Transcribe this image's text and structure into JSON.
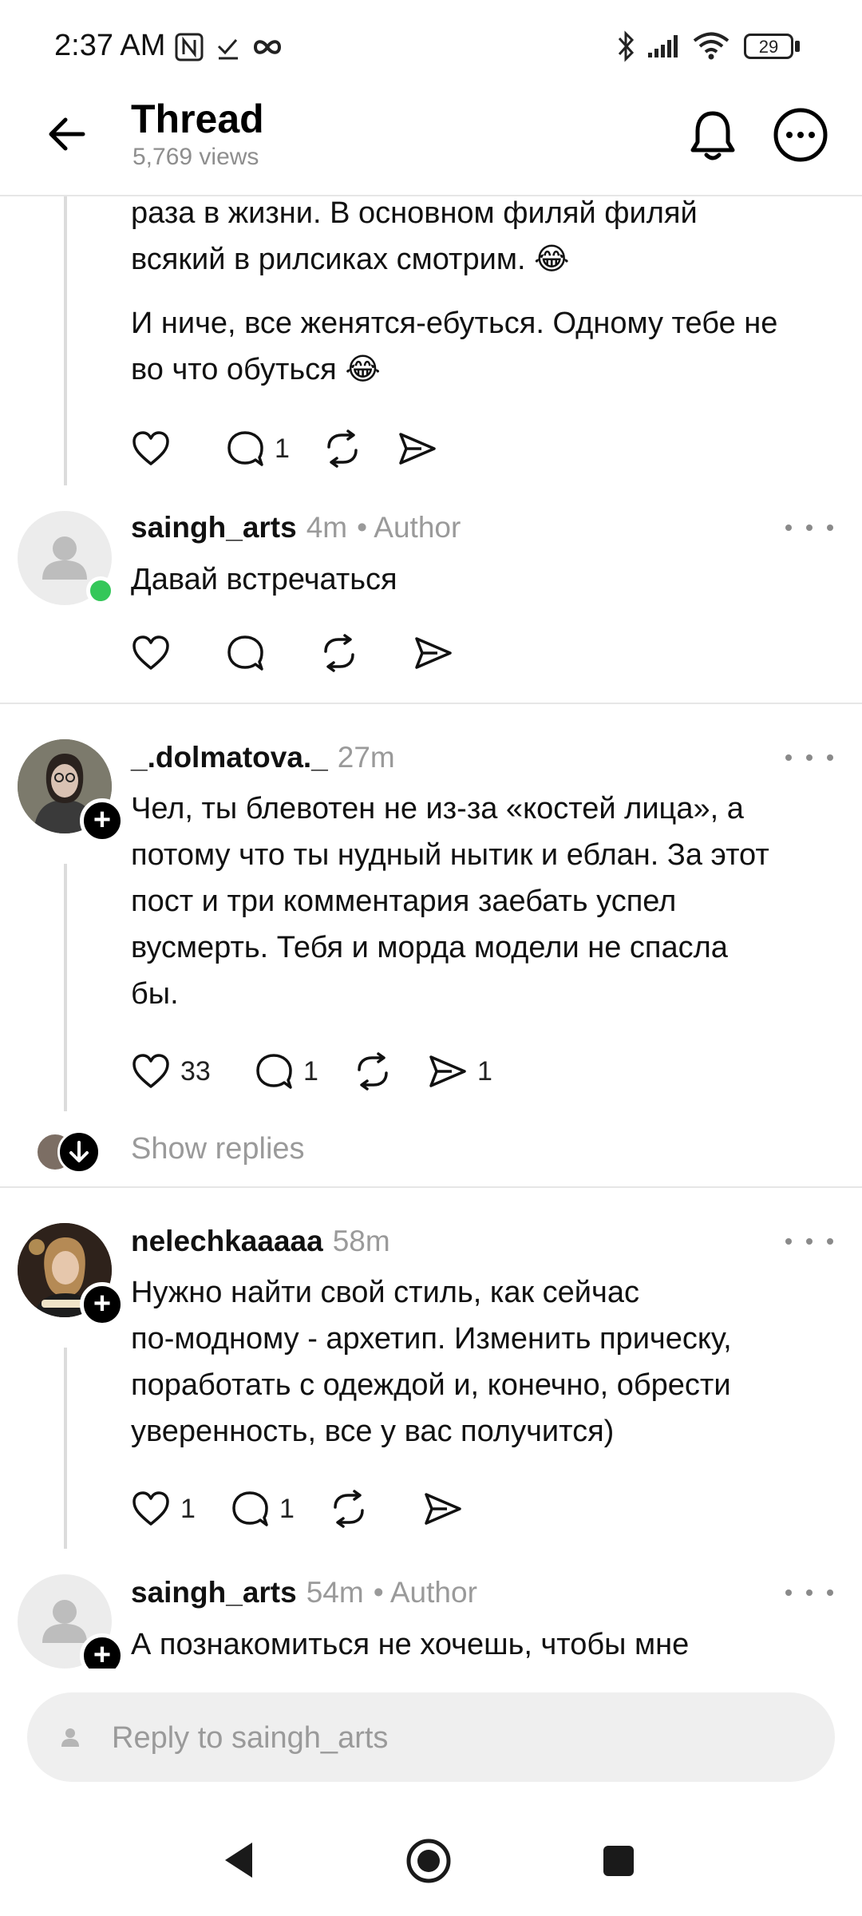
{
  "status_bar": {
    "time": "2:37 AM",
    "battery": "29"
  },
  "header": {
    "title": "Thread",
    "views": "5,769 views"
  },
  "posts": [
    {
      "text_lines": [
        "раза в жизни. В основном филяй филяй",
        "всякий в рилсиках смотрим. 😂"
      ],
      "text2_lines": [
        "И ниче, все женятся-ебуться. Одному тебе не",
        "во что обуться 😂"
      ],
      "likes": "",
      "comments": "1",
      "shares": ""
    },
    {
      "username": "saingh_arts",
      "time": "4m",
      "author_tag": "• Author",
      "text_lines": [
        "Давай встречаться"
      ],
      "likes": "",
      "comments": "",
      "shares": ""
    },
    {
      "username": "_.dolmatova._",
      "time": "27m",
      "text_lines": [
        "Чел, ты блевотен не из-за «костей лица», а",
        "потому что ты нудный нытик и еблан. За этот",
        "пост и три комментария заебать успел",
        "вусмерть. Тебя и морда модели не спасла",
        "бы."
      ],
      "likes": "33",
      "comments": "1",
      "shares": "1",
      "show_replies": "Show replies"
    },
    {
      "username": "nelechkaaaaa",
      "time": "58m",
      "text_lines": [
        "Нужно найти свой стиль, как сейчас",
        "по-модному - архетип. Изменить прическу,",
        "поработать с одеждой и, конечно, обрести",
        "уверенность, все у вас получится)"
      ],
      "likes": "1",
      "comments": "1",
      "shares": ""
    },
    {
      "username": "saingh_arts",
      "time": "54m",
      "author_tag": "• Author",
      "text_lines": [
        "А познакомиться не хочешь, чтобы мне"
      ]
    }
  ],
  "reply": {
    "placeholder": "Reply to saingh_arts"
  },
  "colors": {
    "online": "#34c759",
    "muted": "#9a9a9a",
    "reply_bg": "#efefef"
  }
}
